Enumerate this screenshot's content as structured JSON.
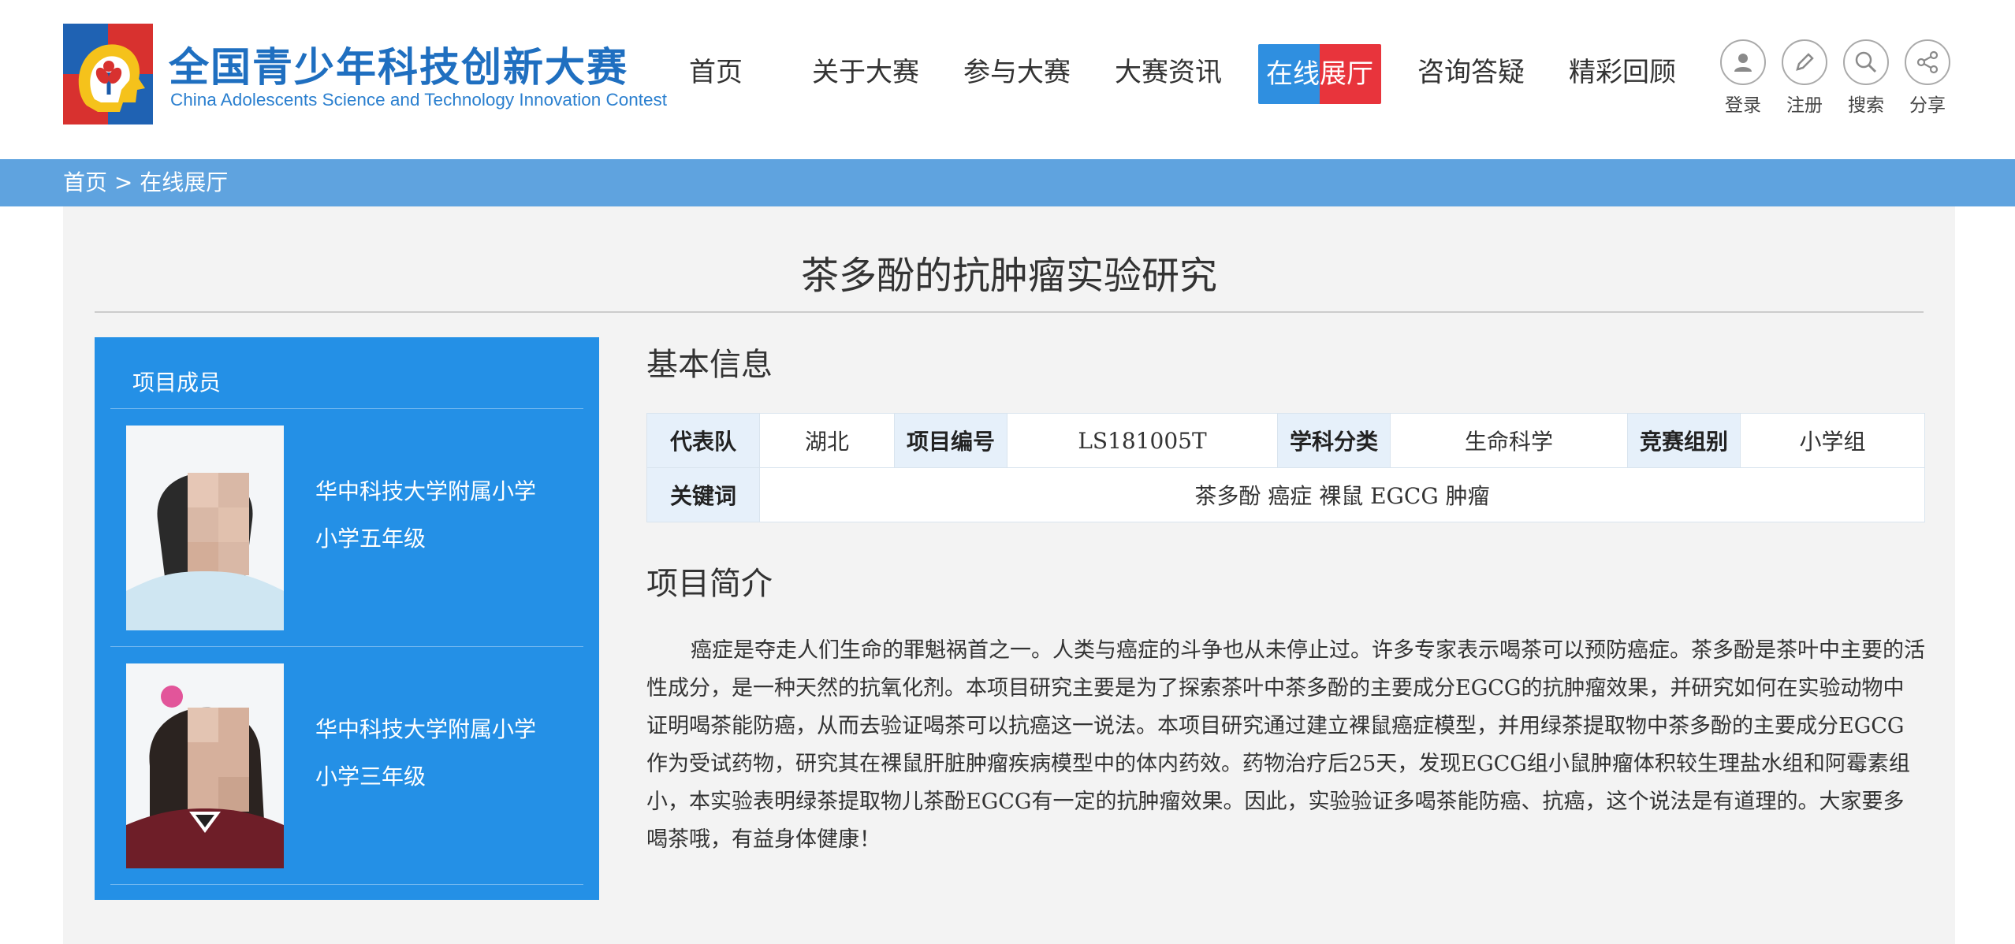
{
  "header": {
    "logo_cn": "全国青少年科技创新大赛",
    "logo_en": "China Adolescents Science and Technology Innovation Contest",
    "nav": [
      {
        "label": "首页"
      },
      {
        "label": "关于大赛"
      },
      {
        "label": "参与大赛"
      },
      {
        "label": "大赛资讯"
      },
      {
        "label": "在线展厅",
        "active": true
      },
      {
        "label": "咨询答疑"
      },
      {
        "label": "精彩回顾"
      }
    ],
    "tools": [
      {
        "label": "登录",
        "icon": "user-icon"
      },
      {
        "label": "注册",
        "icon": "pencil-icon"
      },
      {
        "label": "搜索",
        "icon": "search-icon"
      },
      {
        "label": "分享",
        "icon": "share-icon"
      }
    ]
  },
  "breadcrumb": {
    "home": "首页",
    "sep": " > ",
    "current": "在线展厅"
  },
  "project": {
    "title": "茶多酚的抗肿瘤实验研究",
    "members_title": "项目成员",
    "members": [
      {
        "school": "华中科技大学附属小学",
        "grade": "小学五年级"
      },
      {
        "school": "华中科技大学附属小学",
        "grade": "小学三年级"
      }
    ],
    "basic_info_heading": "基本信息",
    "info": {
      "team_label": "代表队",
      "team": "湖北",
      "id_label": "项目编号",
      "id": "LS181005T",
      "subject_label": "学科分类",
      "subject": "生命科学",
      "group_label": "竞赛组别",
      "group": "小学组",
      "keywords_label": "关键词",
      "keywords": "茶多酚 癌症 裸鼠 EGCG 肿瘤"
    },
    "intro_heading": "项目简介",
    "intro": "癌症是夺走人们生命的罪魁祸首之一。人类与癌症的斗争也从未停止过。许多专家表示喝茶可以预防癌症。茶多酚是茶叶中主要的活性成分，是一种天然的抗氧化剂。本项目研究主要是为了探索茶叶中茶多酚的主要成分EGCG的抗肿瘤效果，并研究如何在实验动物中证明喝茶能防癌，从而去验证喝茶可以抗癌这一说法。本项目研究通过建立裸鼠癌症模型，并用绿茶提取物中茶多酚的主要成分EGCG作为受试药物，研究其在裸鼠肝脏肿瘤疾病模型中的体内药效。药物治疗后25天，发现EGCG组小鼠肿瘤体积较生理盐水组和阿霉素组小，本实验表明绿茶提取物儿茶酚EGCG有一定的抗肿瘤效果。因此，实验验证多喝茶能防癌、抗癌，这个说法是有道理的。大家要多喝茶哦，有益身体健康！"
  },
  "colors": {
    "primary": "#2490e6",
    "crumb_bar": "#5fa3df",
    "logo_blue": "#1f6fc0",
    "accent_red": "#e8343c"
  }
}
